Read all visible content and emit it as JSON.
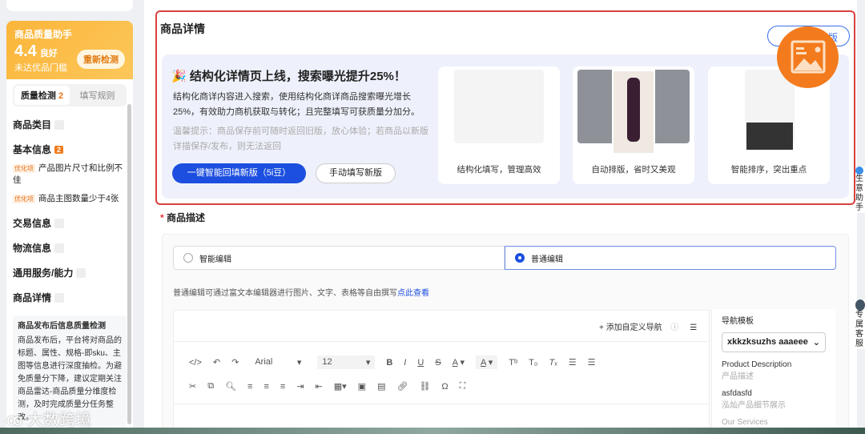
{
  "sidebar": {
    "assistant": {
      "title": "商品质量助手",
      "score": "4.4",
      "rating": "良好",
      "status": "未达优品门槛",
      "recheck": "重新检测"
    },
    "tabs": [
      {
        "label": "质量检测",
        "count": "2"
      },
      {
        "label": "填写规则"
      }
    ],
    "sections": [
      {
        "label": "商品类目",
        "count": "0"
      },
      {
        "label": "基本信息",
        "count": "2",
        "items": [
          {
            "tag": "优化项",
            "text": "产品图片尺寸和比例不佳"
          },
          {
            "tag": "优化项",
            "text": "商品主图数量少于4张"
          }
        ]
      },
      {
        "label": "交易信息",
        "count": "0"
      },
      {
        "label": "物流信息",
        "count": "0"
      },
      {
        "label": "通用服务/能力",
        "count": "0"
      },
      {
        "label": "商品详情",
        "count": "0"
      }
    ],
    "note": {
      "title": "商品发布后信息质量检测",
      "body": "商品发布后，平台将对商品的标题、属性、规格-即sku、主图等信息进行深度抽检。为避免质量分下降，建议定期关注商品雷达-商品质量分维度检测，及时完成质量分任务整改。"
    }
  },
  "detail": {
    "title": "商品详情",
    "old_version": "返回旧版",
    "banner": {
      "headline": "结构化详情页上线，搜索曝光提升25%！",
      "body": "结构化商详内容进入搜索，使用结构化商详商品搜索曝光增长25%，有效助力商机获取与转化；且完整填写可获质量分加分。",
      "tip": "温馨提示：商品保存前可随时返回旧版，放心体验；若商品以新版详描保存/发布，则无法返回",
      "primary": "一键智能回填新版（5i豆）",
      "secondary": "手动填写新版",
      "features": [
        "结构化填写，管理高效",
        "自动排版，省时又美观",
        "智能排序，突出重点"
      ]
    }
  },
  "description": {
    "label": "商品描述",
    "modes": [
      {
        "label": "智能编辑",
        "selected": false
      },
      {
        "label": "普通编辑",
        "selected": true
      }
    ],
    "hint": "普通编辑可通过富文本编辑器进行图片、文字、表格等自由撰写",
    "hint_link": "点此查看",
    "add_nav": "+ 添加自定义导航",
    "toolbar": {
      "font": "Arial",
      "size": "12"
    },
    "nav_panel": {
      "title": "导航模板",
      "selected": "xkkzksuzhs aaaeee",
      "items": [
        {
          "en": "Product Description",
          "zh": "产品描述"
        },
        {
          "en": "asfdasfd",
          "zh": "泓灿产品细节展示"
        },
        {
          "en": "Our Services",
          "zh": ""
        }
      ]
    }
  },
  "right_float": [
    {
      "text": "生意助手"
    },
    {
      "text": "专属客服"
    }
  ],
  "watermark": "大数跨境",
  "colors": {
    "accent": "#1c4fe0",
    "warning": "#f07b1c",
    "highlight": "#d8403f"
  }
}
